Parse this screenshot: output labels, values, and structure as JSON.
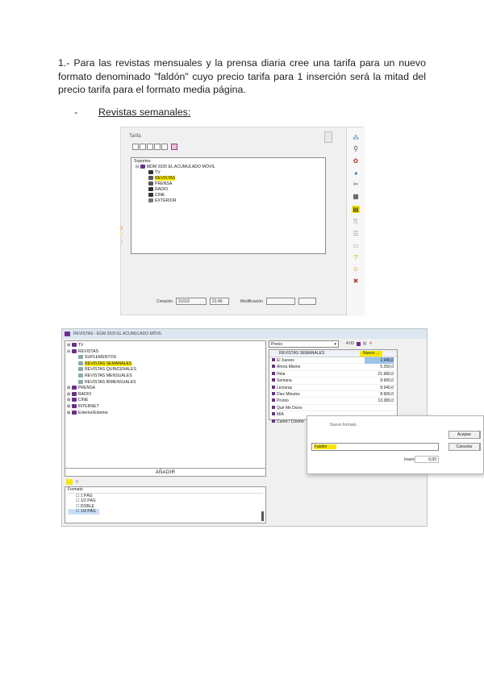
{
  "instruction": "1.- Para las revistas mensuales y la prensa diaria cree una tarifa para un nuevo formato denominado \"faldón\" cuyo precio tarifa para 1 inserción será la mitad del precio tarifa para el formato media página.",
  "bullet": {
    "dash": "-",
    "label": "Revistas semanales:"
  },
  "screenshot1": {
    "window_title": "Tarifa",
    "tree_header": "Soportes",
    "root": "MDM 2020 EL ACUMULADO MÓVIL",
    "nodes": [
      "TV",
      "REVISTAS",
      "PRENSA",
      "RADIO",
      "CINE",
      "EXTERIOR"
    ],
    "highlighted_node": "REVISTAS",
    "status": {
      "label_left": "Creación",
      "date": "21/1/2",
      "time": "21:49",
      "label_right": "Modificación"
    },
    "side_toolbar_icons": [
      "chart-icon",
      "wand-icon",
      "colors-icon",
      "pie-icon",
      "scissors-icon",
      "calculator-icon",
      "rates-icon",
      "page-icon",
      "list-icon",
      "doc-icon",
      "help-icon",
      "exit-icon"
    ],
    "accent": "#f5e700"
  },
  "screenshot2": {
    "window_title": "REVISTAS - EGM 2020 EL ACUMULADO MÓVIL",
    "tree": [
      {
        "text": "TV",
        "level": 0,
        "expander": "+"
      },
      {
        "text": "REVISTAS",
        "level": 0,
        "expander": "-"
      },
      {
        "text": "SUPLEMENTOS",
        "level": 1
      },
      {
        "text": "REVISTAS SEMANALES",
        "level": 1,
        "highlight": true
      },
      {
        "text": "REVISTAS QUINCENALES",
        "level": 1
      },
      {
        "text": "REVISTAS MENSUALES",
        "level": 1
      },
      {
        "text": "REVISTAS BIMENSUALES",
        "level": 1
      },
      {
        "text": "PRENSA",
        "level": 0,
        "expander": "+"
      },
      {
        "text": "RADIO",
        "level": 0,
        "expander": "+"
      },
      {
        "text": "CINE",
        "level": 0,
        "expander": "+"
      },
      {
        "text": "INTERNET",
        "level": 0,
        "expander": "+"
      },
      {
        "text": "Exterior/Exterior",
        "level": 0,
        "expander": "+"
      }
    ],
    "add_button": "AÑADIR",
    "list_header": "Formato",
    "list_items": [
      "1 PÁG",
      "1/2 PÁG",
      "DOBLE",
      "1/4 PÁG"
    ],
    "list_selected_index": 3,
    "combo_value": "Precio",
    "right_toolbar_text": "4:00",
    "grid_header": "REVISTAS SEMANALES",
    "grid_col_header": "Nuevo ...",
    "grid_rows": [
      {
        "name": "El Jueves",
        "value": "1.940,0",
        "selected": true
      },
      {
        "name": "Ahora Mismo",
        "value": "5.250,0"
      },
      {
        "name": "Hola",
        "value": "21.980,0"
      },
      {
        "name": "Semana",
        "value": "8.900,0"
      },
      {
        "name": "Lecturas",
        "value": "8.940,0"
      },
      {
        "name": "Diez Minutos",
        "value": "8.900,0"
      },
      {
        "name": "Pronto",
        "value": "13.380,0"
      },
      {
        "name": "Qué Me Dices",
        "value": ""
      },
      {
        "name": "MIA",
        "value": ""
      },
      {
        "name": "Cuore / Cosmo",
        "value": ""
      }
    ],
    "dialog": {
      "title": "Nuevo formato",
      "input_value": "Faldón",
      "field_label": "Inserc.",
      "field_value": "0,00",
      "accept_label": "Aceptar",
      "cancel_label": "Cancelar"
    }
  }
}
